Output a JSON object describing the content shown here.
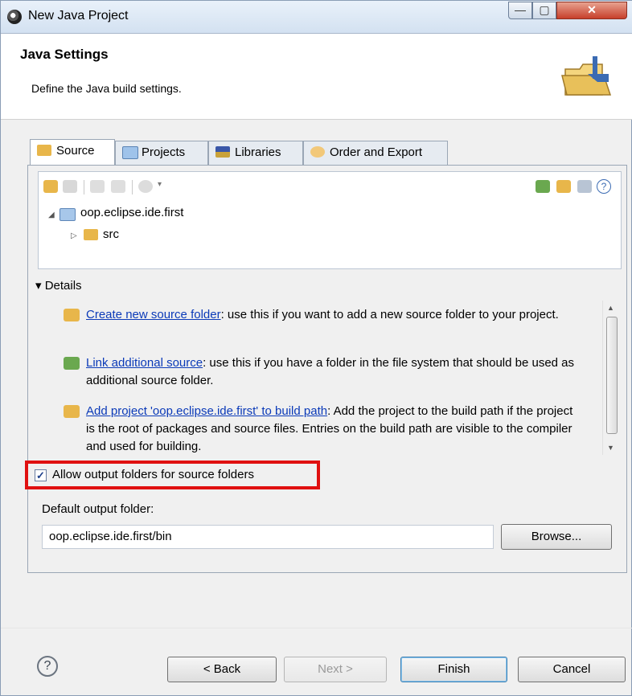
{
  "window": {
    "title": "New Java Project",
    "minimize_glyph": "—",
    "maximize_glyph": "▢",
    "close_glyph": "✕"
  },
  "header": {
    "title": "Java Settings",
    "description": "Define the Java build settings."
  },
  "tabs": [
    {
      "label": "Source",
      "icon": "source-folder-icon",
      "active": true
    },
    {
      "label": "Projects",
      "icon": "projects-icon",
      "active": false
    },
    {
      "label": "Libraries",
      "icon": "libraries-icon",
      "active": false
    },
    {
      "label": "Order and Export",
      "icon": "order-export-icon",
      "active": false
    }
  ],
  "tree": {
    "project": "oop.eclipse.ide.first",
    "child": "src",
    "expanded_glyph": "◢",
    "collapsed_glyph": "▷"
  },
  "details": {
    "toggle_glyph": "▾",
    "label": "Details",
    "items": [
      {
        "link": "Create new source folder",
        "text": ": use this if you want to add a new source folder to your project."
      },
      {
        "link": "Link additional source",
        "text": ": use this if you have a folder in the file system that should be used as additional source folder."
      },
      {
        "link": "Add project 'oop.eclipse.ide.first' to build path",
        "text": ": Add the project to the build path if the project is the root of packages and source files. Entries on the build path are visible to the compiler and used for building."
      }
    ],
    "scroll_up": "▲",
    "scroll_down": "▼"
  },
  "allow_output": {
    "label": "Allow output folders for source folders",
    "checked": true,
    "check_glyph": "✓"
  },
  "output_folder": {
    "label": "Default output folder:",
    "value": "oop.eclipse.ide.first/bin",
    "browse": "Browse..."
  },
  "help_glyph": "?",
  "buttons": {
    "back": "< Back",
    "next": "Next >",
    "finish": "Finish",
    "cancel": "Cancel"
  },
  "colors": {
    "link": "#0b3ab8",
    "highlight": "#e01010",
    "folder": "#e8b64a"
  }
}
